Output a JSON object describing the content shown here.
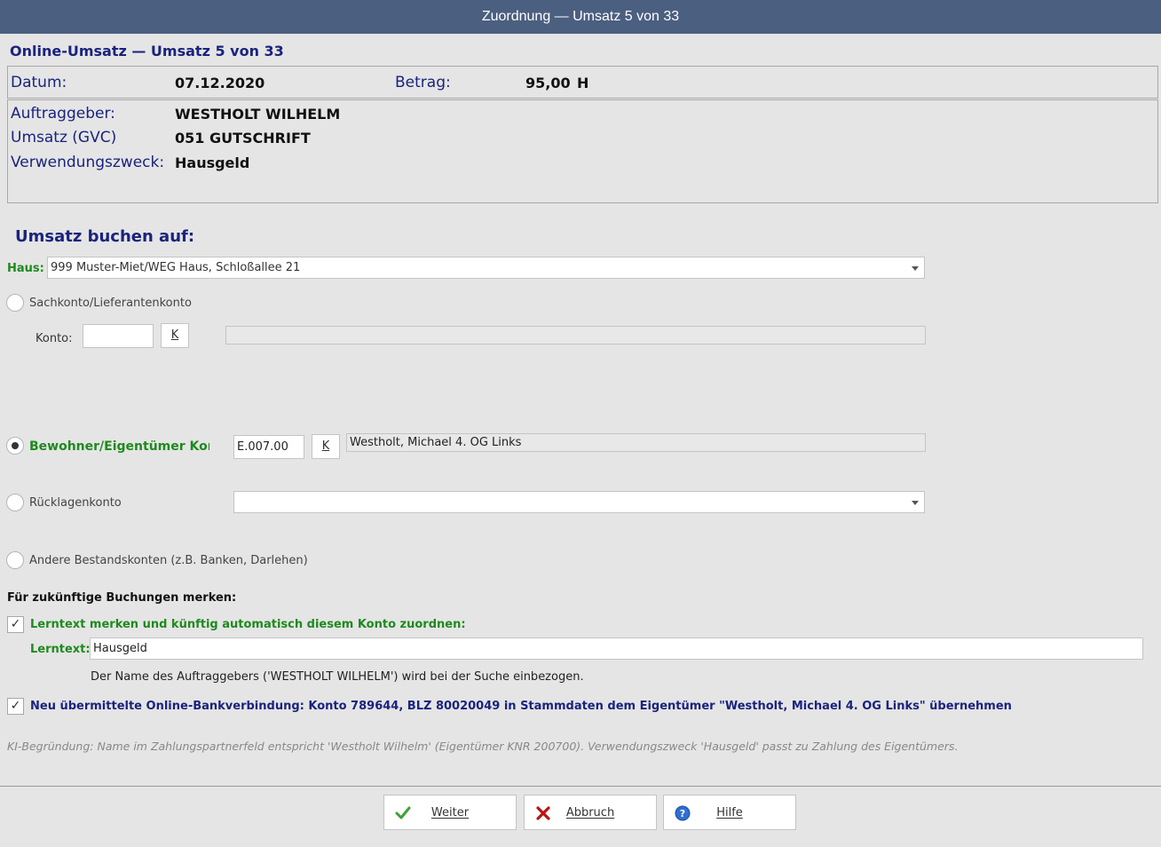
{
  "window": {
    "title": "Zuordnung — Umsatz 5 von 33"
  },
  "header": {
    "title": "Online-Umsatz — Umsatz 5 von 33",
    "datum_label": "Datum:",
    "datum_value": "07.12.2020",
    "betrag_label": "Betrag:",
    "betrag_value": "95,00",
    "betrag_type": "H",
    "auftraggeber_label": "Auftraggeber:",
    "auftraggeber_value": "WESTHOLT WILHELM",
    "umsatz_label": "Umsatz (GVC)",
    "umsatz_value": "051 GUTSCHRIFT",
    "zweck_label": "Verwendungszweck:",
    "zweck_value": "Hausgeld"
  },
  "booking": {
    "section_title": "Umsatz buchen auf:",
    "haus_label": "Haus:",
    "haus_value": "999 Muster-Miet/WEG Haus, Schloßallee 21",
    "options": {
      "sachkonto": {
        "label": "Sachkonto/Lieferantenkonto",
        "selected": false,
        "konto_label": "Konto:",
        "konto_value": "",
        "k_button": "K",
        "description": ""
      },
      "bewohner": {
        "label": "Bewohner/Eigentümer Konto",
        "selected": true,
        "konto_value": "E.007.00",
        "k_button": "K",
        "description": "Westholt, Michael 4. OG Links"
      },
      "ruecklagen": {
        "label": "Rücklagenkonto",
        "selected": false,
        "value": ""
      },
      "andere": {
        "label": "Andere Bestandskonten (z.B. Banken, Darlehen)",
        "selected": false
      }
    }
  },
  "memory": {
    "title": "Für zukünftige Buchungen merken:",
    "lerntext_checkbox": {
      "checked": true,
      "label": "Lerntext merken und künftig automatisch diesem Konto zuordnen:"
    },
    "lerntext_label": "Lerntext:",
    "lerntext_value": "Hausgeld",
    "hint": "Der Name des Auftraggebers ('WESTHOLT WILHELM') wird bei der Suche einbezogen.",
    "bank_checkbox": {
      "checked": true,
      "label": "Neu übermittelte Online-Bankverbindung: Konto 789644, BLZ 80020049 in Stammdaten dem Eigentümer \"Westholt, Michael 4. OG Links\" übernehmen"
    }
  },
  "ai_reason": "KI-Begründung: Name im Zahlungspartnerfeld entspricht 'Westholt Wilhelm' (Eigentümer KNR 200700). Verwendungszweck 'Hausgeld' passt zu Zahlung des Eigentümers.",
  "buttons": {
    "weiter": {
      "label": "Weiter",
      "icon": "check-icon"
    },
    "abbruch": {
      "label": "Abbruch",
      "icon": "x-icon"
    },
    "hilfe": {
      "label": "Hilfe",
      "icon": "help-icon"
    }
  },
  "colors": {
    "titlebar": "#4b5f80",
    "label_blue": "#1a237e",
    "label_green": "#1e8a1e"
  }
}
